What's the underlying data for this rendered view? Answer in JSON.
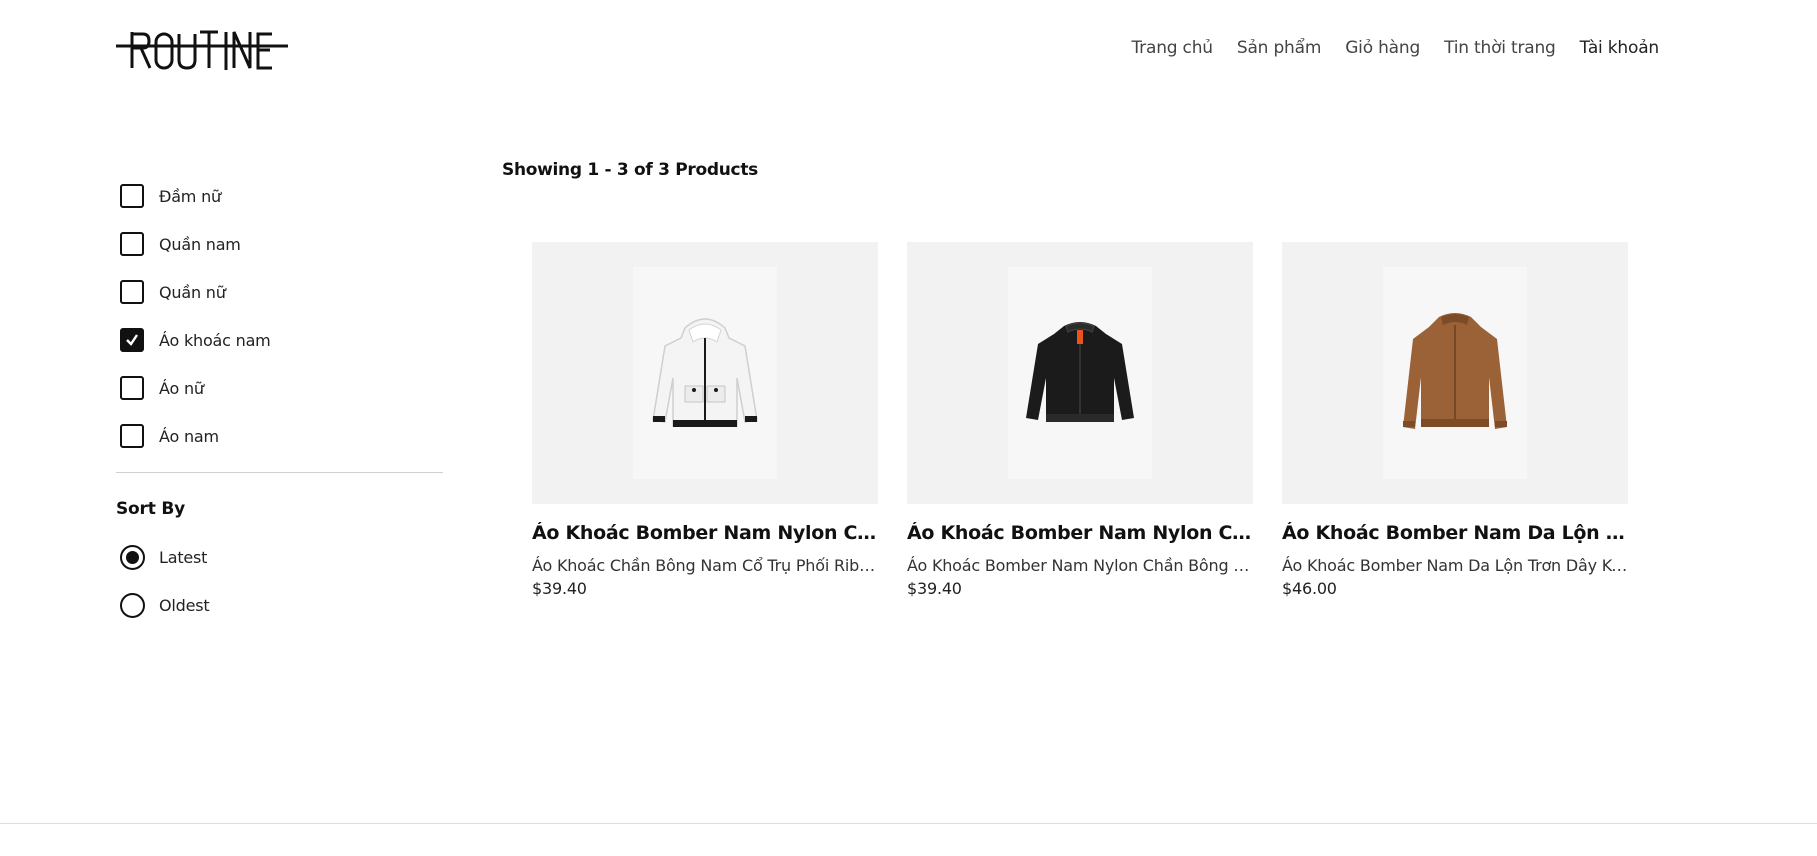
{
  "brand": {
    "logo_text": "ROUTINE"
  },
  "nav": {
    "items": [
      {
        "label": "Trang chủ"
      },
      {
        "label": "Sản phẩm"
      },
      {
        "label": "Giỏ hàng"
      },
      {
        "label": "Tin thời trang"
      },
      {
        "label": "Tài khoản"
      }
    ]
  },
  "filters": {
    "categories": [
      {
        "label": "Đầm nữ",
        "checked": false
      },
      {
        "label": "Quần nam",
        "checked": false
      },
      {
        "label": "Quần nữ",
        "checked": false
      },
      {
        "label": "Áo khoác nam",
        "checked": true
      },
      {
        "label": "Áo nữ",
        "checked": false
      },
      {
        "label": "Áo nam",
        "checked": false
      }
    ],
    "sort_title": "Sort By",
    "sort_options": [
      {
        "label": "Latest",
        "selected": true
      },
      {
        "label": "Oldest",
        "selected": false
      }
    ]
  },
  "results": {
    "showing_text": "Showing 1 - 3 of 3 Products"
  },
  "products": [
    {
      "title": "Áo Khoác Bomber Nam Nylon Chần Bông Cổ Trụ Phối Rib",
      "description": "Áo Khoác Chần Bông Nam Cổ Trụ Phối Rib Màu Trắng",
      "price": "$39.40",
      "image_icon": "white-hooded-jacket-icon",
      "colors": {
        "body": "#f4f4f4",
        "trim": "#1a1a1a"
      }
    },
    {
      "title": "Áo Khoác Bomber Nam Nylon Chần Bông Màu Đen",
      "description": "Áo Khoác Bomber Nam Nylon Chần Bông Màu Đen Khóa Kéo",
      "price": "$39.40",
      "image_icon": "black-bomber-jacket-icon",
      "colors": {
        "body": "#1b1b1b",
        "trim": "#e8541c"
      }
    },
    {
      "title": "Áo Khoác Bomber Nam Da Lộn Trơn Dây Kéo",
      "description": "Áo Khoác Bomber Nam Da Lộn Trơn Dây Kéo Màu Nâu",
      "price": "$46.00",
      "image_icon": "brown-suede-bomber-jacket-icon",
      "colors": {
        "body": "#9a6236",
        "trim": "#7c4c28"
      }
    }
  ]
}
